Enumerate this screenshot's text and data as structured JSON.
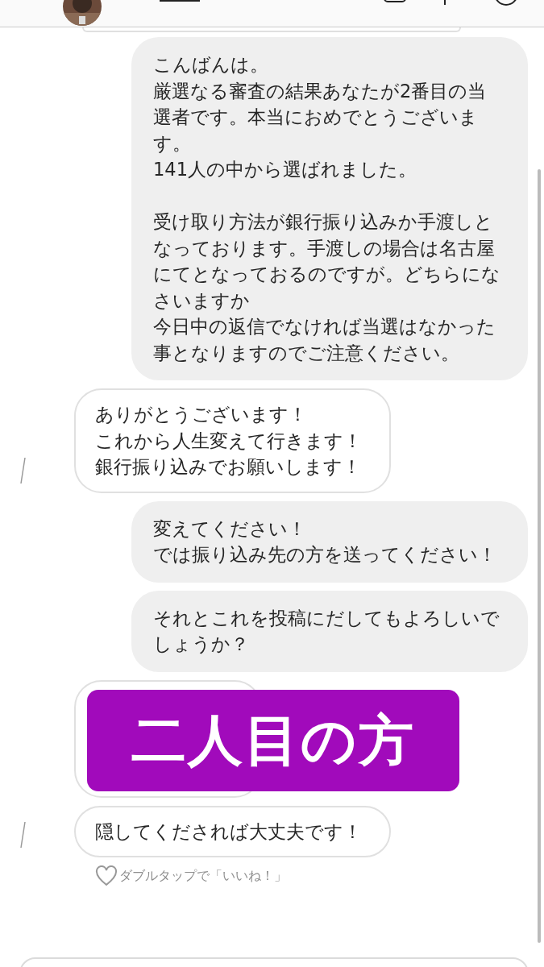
{
  "messages": [
    {
      "kind": "sent",
      "paragraphs": [
        [
          "こんばんは。",
          "厳選なる審査の結果あなたが2番目の当選者です。本当におめでとうございます。",
          "141人の中から選ばれました。"
        ],
        [
          "受け取り方法が銀行振り込みか手渡しとなっております。手渡しの場合は名古屋にてとなっておるのですが。どちらになさいますか",
          "今日中の返信でなければ当選はなかった事となりますのでご注意ください。"
        ]
      ]
    },
    {
      "kind": "received",
      "paragraphs": [
        [
          "ありがとうございます！",
          "これから人生変えて行きます！",
          "銀行振り込みでお願いします！"
        ]
      ]
    },
    {
      "kind": "sent",
      "paragraphs": [
        [
          "変えてください！",
          "では振り込み先の方を送ってください！"
        ]
      ]
    },
    {
      "kind": "sent",
      "paragraphs": [
        [
          "それとこれを投稿にだしてもよろしいでしょうか？"
        ]
      ]
    },
    {
      "kind": "covered",
      "overlay": "二人目の方"
    },
    {
      "kind": "received",
      "paragraphs": [
        [
          "隠してくだされば大丈夫です！"
        ]
      ]
    }
  ],
  "like_hint": "ダブルタップで「いいね！」"
}
